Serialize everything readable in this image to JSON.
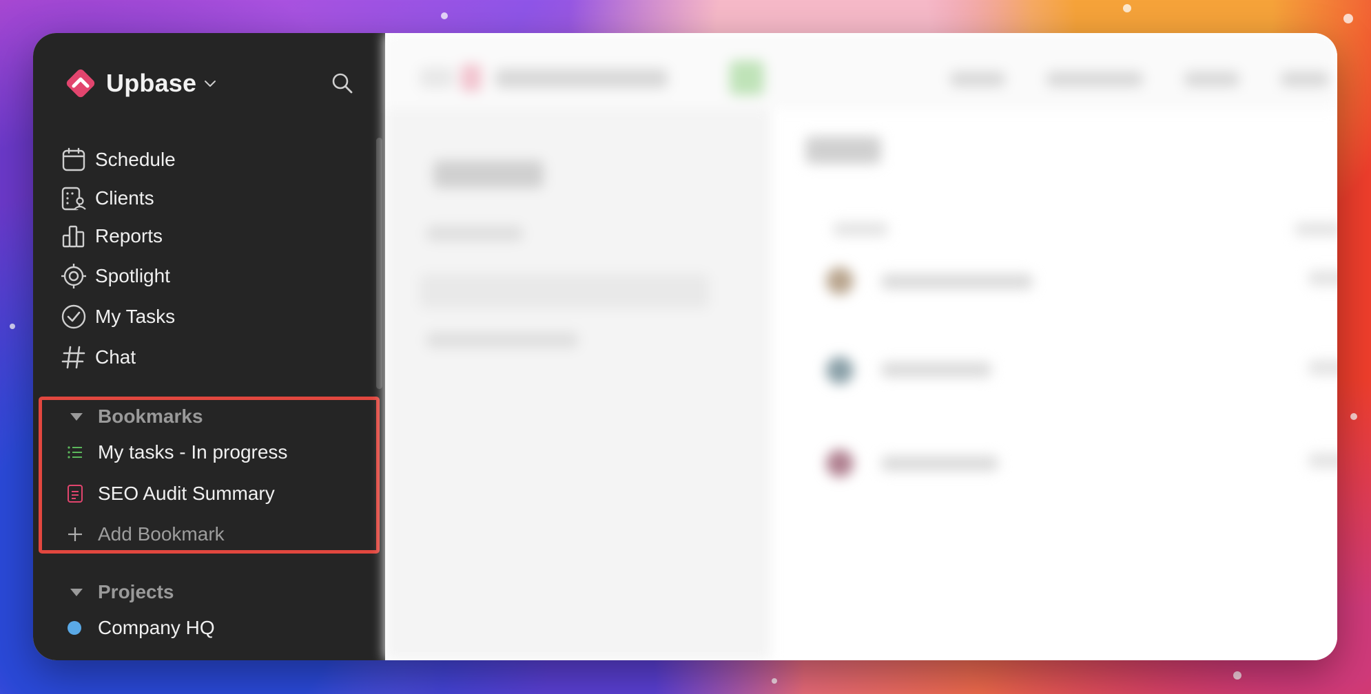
{
  "app": {
    "name": "Upbase",
    "logo_color": "#e2456e"
  },
  "nav": [
    {
      "label": "Schedule",
      "icon": "calendar-icon"
    },
    {
      "label": "Clients",
      "icon": "clients-icon"
    },
    {
      "label": "Reports",
      "icon": "bar-chart-icon"
    },
    {
      "label": "Spotlight",
      "icon": "spotlight-icon"
    },
    {
      "label": "My Tasks",
      "icon": "check-circle-icon"
    },
    {
      "label": "Chat",
      "icon": "hash-icon"
    }
  ],
  "bookmarks": {
    "title": "Bookmarks",
    "items": [
      {
        "label": "My tasks - In progress",
        "icon": "list-icon",
        "color": "#5cb85c"
      },
      {
        "label": "SEO Audit Summary",
        "icon": "document-icon",
        "color": "#e2456e"
      }
    ],
    "add_label": "Add Bookmark"
  },
  "projects": {
    "title": "Projects",
    "items": [
      {
        "label": "Company HQ",
        "color": "#5aa9e6"
      }
    ]
  },
  "colors": {
    "sidebar_bg": "#252525",
    "highlight": "#e2473f"
  }
}
